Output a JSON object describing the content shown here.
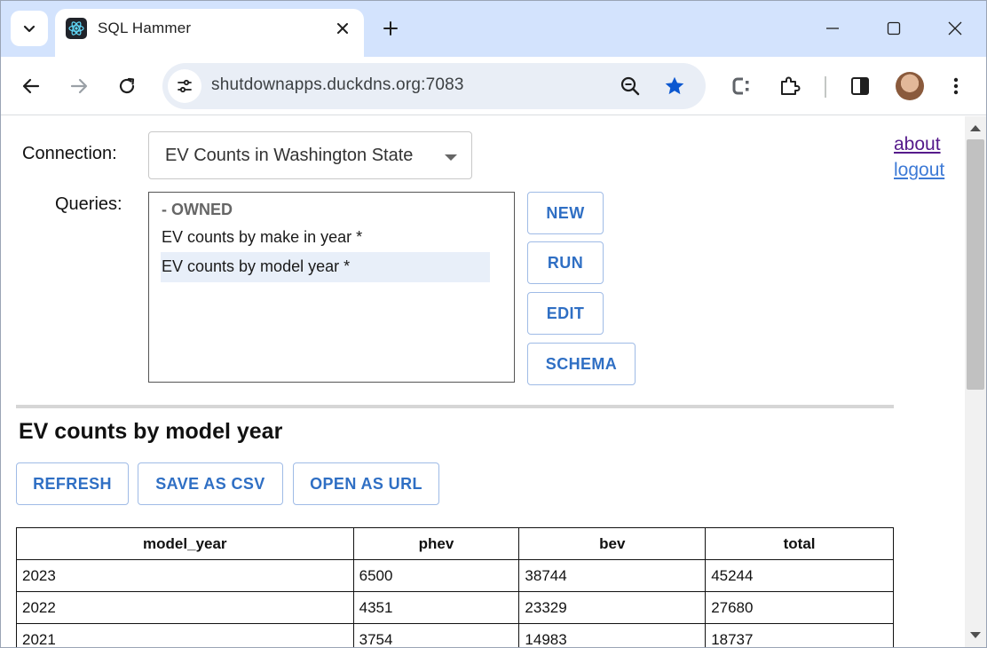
{
  "browser": {
    "tab": {
      "title": "SQL Hammer",
      "favicon": "react-atom-icon"
    },
    "address": {
      "url": "shutdownapps.duckdns.org:7083"
    },
    "colors": {
      "tabstrip": "#d3e3fd",
      "omnibox": "#e9eef6",
      "bookmark_star": "#0b57d0"
    }
  },
  "app": {
    "connection": {
      "label": "Connection:",
      "selected": "EV Counts in Washington State"
    },
    "queries": {
      "label": "Queries:",
      "group": "- OWNED",
      "items": [
        {
          "label": "EV counts by make in year *",
          "selected": false
        },
        {
          "label": "EV counts by model year *",
          "selected": true
        }
      ]
    },
    "query_buttons": {
      "new": "NEW",
      "run": "RUN",
      "edit": "EDIT",
      "schema": "SCHEMA"
    },
    "links": {
      "about": "about",
      "logout": "logout"
    },
    "result": {
      "title": "EV counts by model year",
      "actions": {
        "refresh": "REFRESH",
        "save_csv": "SAVE AS CSV",
        "open_url": "OPEN AS URL"
      },
      "columns": [
        "model_year",
        "phev",
        "bev",
        "total"
      ],
      "rows": [
        [
          "2023",
          "6500",
          "38744",
          "45244"
        ],
        [
          "2022",
          "4351",
          "23329",
          "27680"
        ],
        [
          "2021",
          "3754",
          "14983",
          "18737"
        ]
      ]
    },
    "colors": {
      "accent": "#2f6fc4",
      "selected_row": "#e8eff9",
      "visited_link": "#551a8b"
    }
  }
}
